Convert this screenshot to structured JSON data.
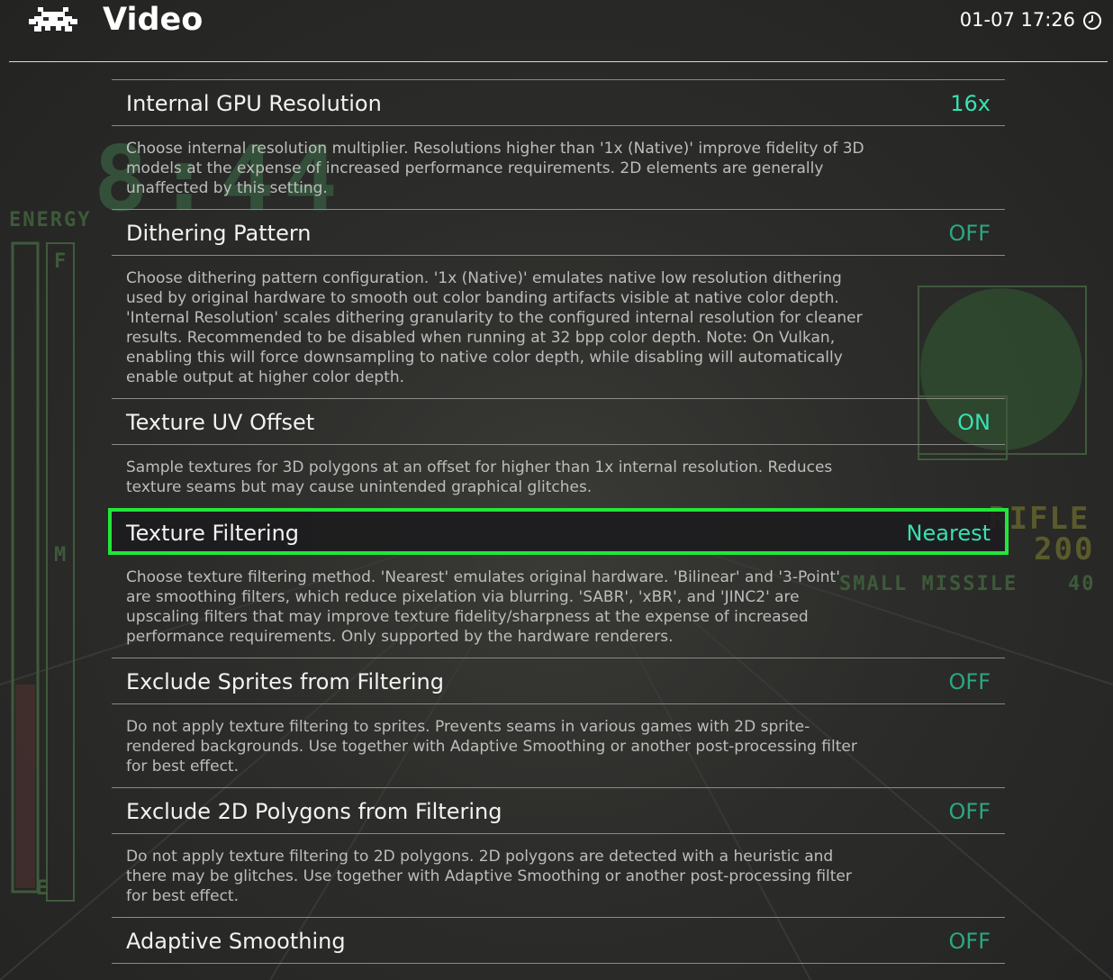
{
  "header": {
    "title": "Video",
    "clock": "01-07 17:26",
    "logo_icon": "retroarch-invader-icon",
    "clock_icon": "clock-icon"
  },
  "settings": [
    {
      "label": "Internal GPU Resolution",
      "value": "16x",
      "value_state": "on",
      "description": "Choose internal resolution multiplier. Resolutions higher than '1x (Native)' improve fidelity of 3D models at the expense of increased performance requirements. 2D elements are generally unaffected by this setting."
    },
    {
      "label": "Dithering Pattern",
      "value": "OFF",
      "value_state": "off",
      "description": "Choose dithering pattern configuration. '1x (Native)' emulates native low resolution dithering used by original hardware to smooth out color banding artifacts visible at native color depth. 'Internal Resolution' scales dithering granularity to the configured internal resolution for cleaner results. Recommended to be disabled when running at 32 bpp color depth. Note: On Vulkan, enabling this will force downsampling to native color depth, while disabling will automatically enable output at higher color depth."
    },
    {
      "label": "Texture UV Offset",
      "value": "ON",
      "value_state": "on",
      "description": "Sample textures for 3D polygons at an offset for higher than 1x internal resolution. Reduces texture seams but may cause unintended graphical glitches."
    },
    {
      "label": "Texture Filtering",
      "value": "Nearest",
      "value_state": "on",
      "selected": true,
      "description": "Choose texture filtering method. 'Nearest' emulates original hardware. 'Bilinear' and '3-Point' are smoothing filters, which reduce pixelation via blurring. 'SABR', 'xBR', and 'JINC2' are upscaling filters that may improve texture fidelity/sharpness at the expense of increased performance requirements. Only supported by the hardware renderers."
    },
    {
      "label": "Exclude Sprites from Filtering",
      "value": "OFF",
      "value_state": "off",
      "description": "Do not apply texture filtering to sprites. Prevents seams in various games with 2D sprite-rendered backgrounds. Use together with Adaptive Smoothing or another post-processing filter for best effect."
    },
    {
      "label": "Exclude 2D Polygons from Filtering",
      "value": "OFF",
      "value_state": "off",
      "description": "Do not apply texture filtering to 2D polygons. 2D polygons are detected with a heuristic and there may be glitches. Use together with Adaptive Smoothing or another post-processing filter for best effect."
    },
    {
      "label": "Adaptive Smoothing",
      "value": "OFF",
      "value_state": "off",
      "description": ""
    }
  ],
  "background_hud": {
    "energy": "ENERGY",
    "score": "8:44",
    "rifle": "RIFLE",
    "ammo": "200",
    "missile": "SMALL MISSILE",
    "missile_count": "40",
    "gauge_top": "F",
    "gauge_mid": "M",
    "gauge_bottom": "E"
  },
  "colors": {
    "selection_border": "#22e63a",
    "value_on": "#39e0b0",
    "value_off": "#2aa882"
  }
}
